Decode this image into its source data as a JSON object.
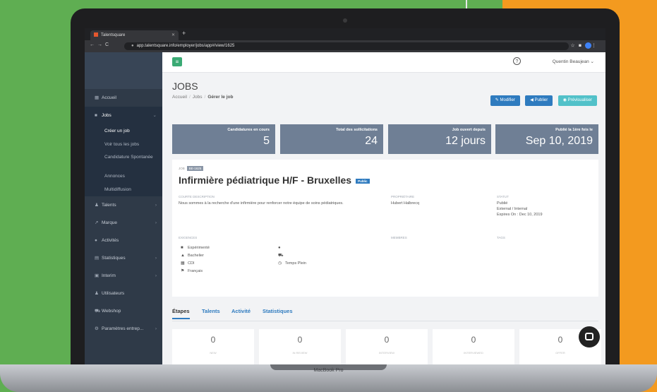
{
  "device": {
    "label": "MacBook Pro"
  },
  "browser": {
    "tab_title": "Talentsquare",
    "url": "app.talentsquare.info/employer/jobs/app#/view/1625"
  },
  "topbar": {
    "user_name": "Quentin Beaujean"
  },
  "sidebar": {
    "items": [
      {
        "label": "Accueil",
        "icon": "grid-icon"
      },
      {
        "label": "Jobs",
        "icon": "briefcase-icon"
      },
      {
        "label": "Talents",
        "icon": "users-icon"
      },
      {
        "label": "Marque",
        "icon": "chart-icon"
      },
      {
        "label": "Activités",
        "icon": "comments-icon"
      },
      {
        "label": "Statistiques",
        "icon": "bar-chart-icon"
      },
      {
        "label": "Interim",
        "icon": "calendar-icon"
      },
      {
        "label": "Utilisateurs",
        "icon": "user-group-icon"
      },
      {
        "label": "Webshop",
        "icon": "cart-icon"
      },
      {
        "label": "Paramètres entrep...",
        "icon": "gear-icon"
      }
    ],
    "jobs_sub": [
      "Créer un job",
      "Voir tous les jobs",
      "Candidature Spontanée",
      "Annonces",
      "Multidiffusion"
    ]
  },
  "header": {
    "title": "JOBS",
    "breadcrumb": [
      "Accueil",
      "Jobs",
      "Gérer le job"
    ]
  },
  "actions": {
    "modify": "Modifier",
    "publish": "Publier",
    "preview": "Prévisualiser"
  },
  "stats": [
    {
      "label": "Candidatures en cours",
      "value": "5"
    },
    {
      "label": "Total des sollicitations",
      "value": "24"
    },
    {
      "label": "Job ouvert depuis",
      "value": "12 jours"
    },
    {
      "label": "Publié la 1ère fois le",
      "value": "Sep 10, 2019"
    }
  ],
  "job": {
    "tag_label": "JOB",
    "tag_value": "BE-1625",
    "title": "Infirmière pédiatrique H/F - Bruxelles",
    "badge": "Public",
    "desc_heading": "COURTE DESCRIPTION",
    "desc": "Nous sommes à la recherche d'une infirmière pour renforcer notre équipe de soins pédiatriques.",
    "owner_heading": "PROPRIÉTAIRE",
    "owner": "Hubert Halbrecq",
    "status_heading": "STATUT",
    "status_lines": [
      "Publié",
      "External / Internal",
      "Expires On : Dec 10, 2019"
    ],
    "req_heading": "EXIGENCES",
    "members_heading": "MEMBRES",
    "tags_heading": "TAGS",
    "requirements_left": [
      "Expérimenté",
      "Bachelier",
      "CDI",
      "Français"
    ],
    "requirements_right": [
      "",
      "",
      "Temps Plein"
    ]
  },
  "tabs": [
    "Étapes",
    "Talents",
    "Activité",
    "Statistiques"
  ],
  "counters": [
    {
      "value": "0",
      "label": "NEW"
    },
    {
      "value": "0",
      "label": "IN REVIEW"
    },
    {
      "value": "0",
      "label": "INTERVIEW"
    },
    {
      "value": "0",
      "label": "INTERVIEWED"
    },
    {
      "value": "0",
      "label": "OFFER"
    }
  ]
}
